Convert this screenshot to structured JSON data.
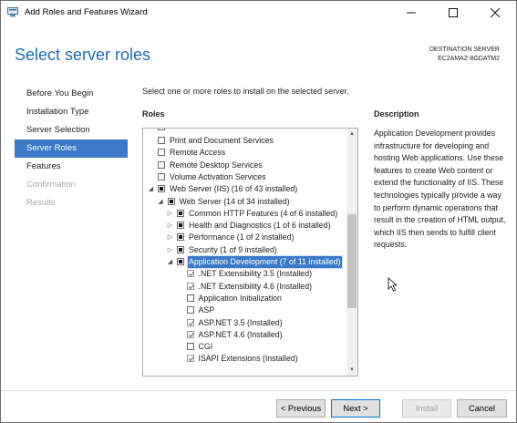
{
  "window": {
    "title": "Add Roles and Features Wizard"
  },
  "header": {
    "page_title": "Select server roles",
    "destination_label": "DESTINATION SERVER",
    "destination_server": "EC2AMAZ-8GDATM2"
  },
  "nav": {
    "items": [
      {
        "label": "Before You Begin",
        "state": "normal"
      },
      {
        "label": "Installation Type",
        "state": "normal"
      },
      {
        "label": "Server Selection",
        "state": "normal"
      },
      {
        "label": "Server Roles",
        "state": "active"
      },
      {
        "label": "Features",
        "state": "normal"
      },
      {
        "label": "Confirmation",
        "state": "disabled"
      },
      {
        "label": "Results",
        "state": "disabled"
      }
    ]
  },
  "main": {
    "instruction": "Select one or more roles to install on the selected server.",
    "roles_header": "Roles",
    "roles": [
      {
        "label": "Print and Document Services",
        "state": "unchecked",
        "expander": "none",
        "level": 0
      },
      {
        "label": "Remote Access",
        "state": "unchecked",
        "expander": "none",
        "level": 0
      },
      {
        "label": "Remote Desktop Services",
        "state": "unchecked",
        "expander": "none",
        "level": 0
      },
      {
        "label": "Volume Activation Services",
        "state": "unchecked",
        "expander": "none",
        "level": 0
      },
      {
        "label": "Web Server (IIS) (16 of 43 installed)",
        "state": "partial",
        "expander": "expanded",
        "level": 0
      },
      {
        "label": "Web Server (14 of 34 installed)",
        "state": "partial",
        "expander": "expanded",
        "level": 1
      },
      {
        "label": "Common HTTP Features (4 of 6 installed)",
        "state": "partial",
        "expander": "collapsed",
        "level": 2
      },
      {
        "label": "Health and Diagnostics (1 of 6 installed)",
        "state": "partial",
        "expander": "collapsed",
        "level": 2
      },
      {
        "label": "Performance (1 of 2 installed)",
        "state": "partial",
        "expander": "collapsed",
        "level": 2
      },
      {
        "label": "Security (1 of 9 installed)",
        "state": "partial",
        "expander": "collapsed",
        "level": 2
      },
      {
        "label": "Application Development (7 of 11 installed)",
        "state": "partial",
        "expander": "expanded",
        "level": 2,
        "selected": true
      },
      {
        "label": ".NET Extensibility 3.5 (Installed)",
        "state": "checked",
        "expander": "none",
        "level": 3
      },
      {
        "label": ".NET Extensibility 4.6 (Installed)",
        "state": "checked",
        "expander": "none",
        "level": 3
      },
      {
        "label": "Application Initialization",
        "state": "unchecked",
        "expander": "none",
        "level": 3
      },
      {
        "label": "ASP",
        "state": "unchecked",
        "expander": "none",
        "level": 3
      },
      {
        "label": "ASP.NET 3.5 (Installed)",
        "state": "checked",
        "expander": "none",
        "level": 3
      },
      {
        "label": "ASP.NET 4.6 (Installed)",
        "state": "checked",
        "expander": "none",
        "level": 3
      },
      {
        "label": "CGI",
        "state": "unchecked",
        "expander": "none",
        "level": 3
      },
      {
        "label": "ISAPI Extensions (Installed)",
        "state": "checked",
        "expander": "none",
        "level": 3
      }
    ],
    "description_header": "Description",
    "description_text": "Application Development provides infrastructure for developing and hosting Web applications. Use these features to create Web content or extend the functionality of IIS. These technologies typically provide a way to perform dynamic operations that result in the creation of HTML output, which IIS then sends to fulfill client requests."
  },
  "footer": {
    "previous": "< Previous",
    "next": "Next >",
    "install": "Install",
    "cancel": "Cancel"
  }
}
